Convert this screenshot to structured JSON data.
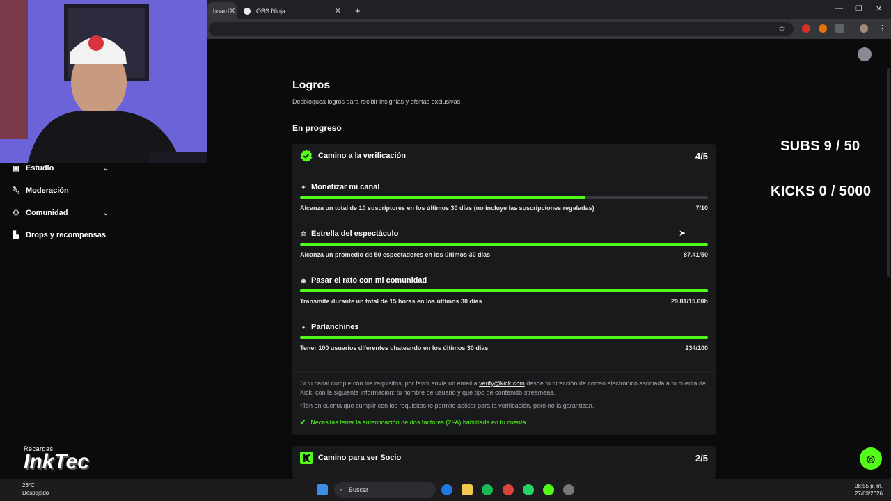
{
  "browser": {
    "tabs": [
      {
        "label": "board",
        "active": true
      },
      {
        "label": "OBS.Ninja",
        "active": false
      }
    ],
    "new_tab": "+",
    "window_controls": [
      "—",
      "❐",
      "✕"
    ]
  },
  "sidebar": {
    "items": [
      {
        "label": "Estudio",
        "icon": "studio-icon",
        "expandable": true
      },
      {
        "label": "Moderación",
        "icon": "wrench-icon",
        "expandable": false
      },
      {
        "label": "Comunidad",
        "icon": "community-icon",
        "expandable": true
      },
      {
        "label": "Drops y recompensas",
        "icon": "drops-icon",
        "expandable": false
      }
    ]
  },
  "main": {
    "title": "Logros",
    "subtitle": "Desbloquea logros para recibir insignias y ofertas exclusivas",
    "section": "En progreso",
    "cards": [
      {
        "title": "Camino a la verificación",
        "count": "4/5",
        "achievements": [
          {
            "name": "Monetizar mi canal",
            "icon": "sparkle-icon",
            "description": "Alcanza un total de 10 suscriptores en los últimos 30 días (no incluye las suscripciones regaladas)",
            "value": "7/10",
            "progress": 0.7
          },
          {
            "name": "Estrella del espectáculo",
            "icon": "star-people-icon",
            "description": "Alcanza un promedio de 50 espectadores en los últimos 30 días",
            "value": "87.41/50",
            "progress": 1.0
          },
          {
            "name": "Pasar el rato con mi comunidad",
            "icon": "broadcast-icon",
            "description": "Transmite durante un total de 15 horas en los últimos 30 días",
            "value": "29.81/15.00h",
            "progress": 1.0
          },
          {
            "name": "Parlanchines",
            "icon": "chat-icon",
            "description": "Tener 100 usuarios diferentes chateando en los últimos 30 días",
            "value": "234/100",
            "progress": 1.0
          }
        ],
        "note_before_link": "Si tu canal cumple con los requisitos, por favor envía un email a ",
        "note_link": "verify@kick.com",
        "note_after_link": " desde tu dirección de correo electrónico asociada a tu cuenta de Kick, con la siguiente información: tu nombre de usuario y qué tipo de contenido streameas.",
        "disclaimer": "*Ten en cuenta que cumplir con los requisitos te permite aplicar para la verificación, pero no la garantizan.",
        "requirement": "Necesitas tener la autenticación de dos factores (2FA) habilitada en tu cuenta"
      },
      {
        "title": "Camino para ser Socio",
        "count": "2/5"
      }
    ]
  },
  "overlay": {
    "subs": "SUBS 9 / 50",
    "kicks": "KICKS 0 / 5000"
  },
  "watermark": {
    "small": "Recargas",
    "big": "InkTec"
  },
  "taskbar": {
    "search_placeholder": "Buscar",
    "weather_temp": "26°C",
    "weather_desc": "Despejado",
    "time": "08:55 p. m.",
    "date": "27/03/2026"
  },
  "colors": {
    "accent": "#53fc18",
    "card_bg": "#191a1c",
    "page_bg": "#0b0b0c"
  }
}
